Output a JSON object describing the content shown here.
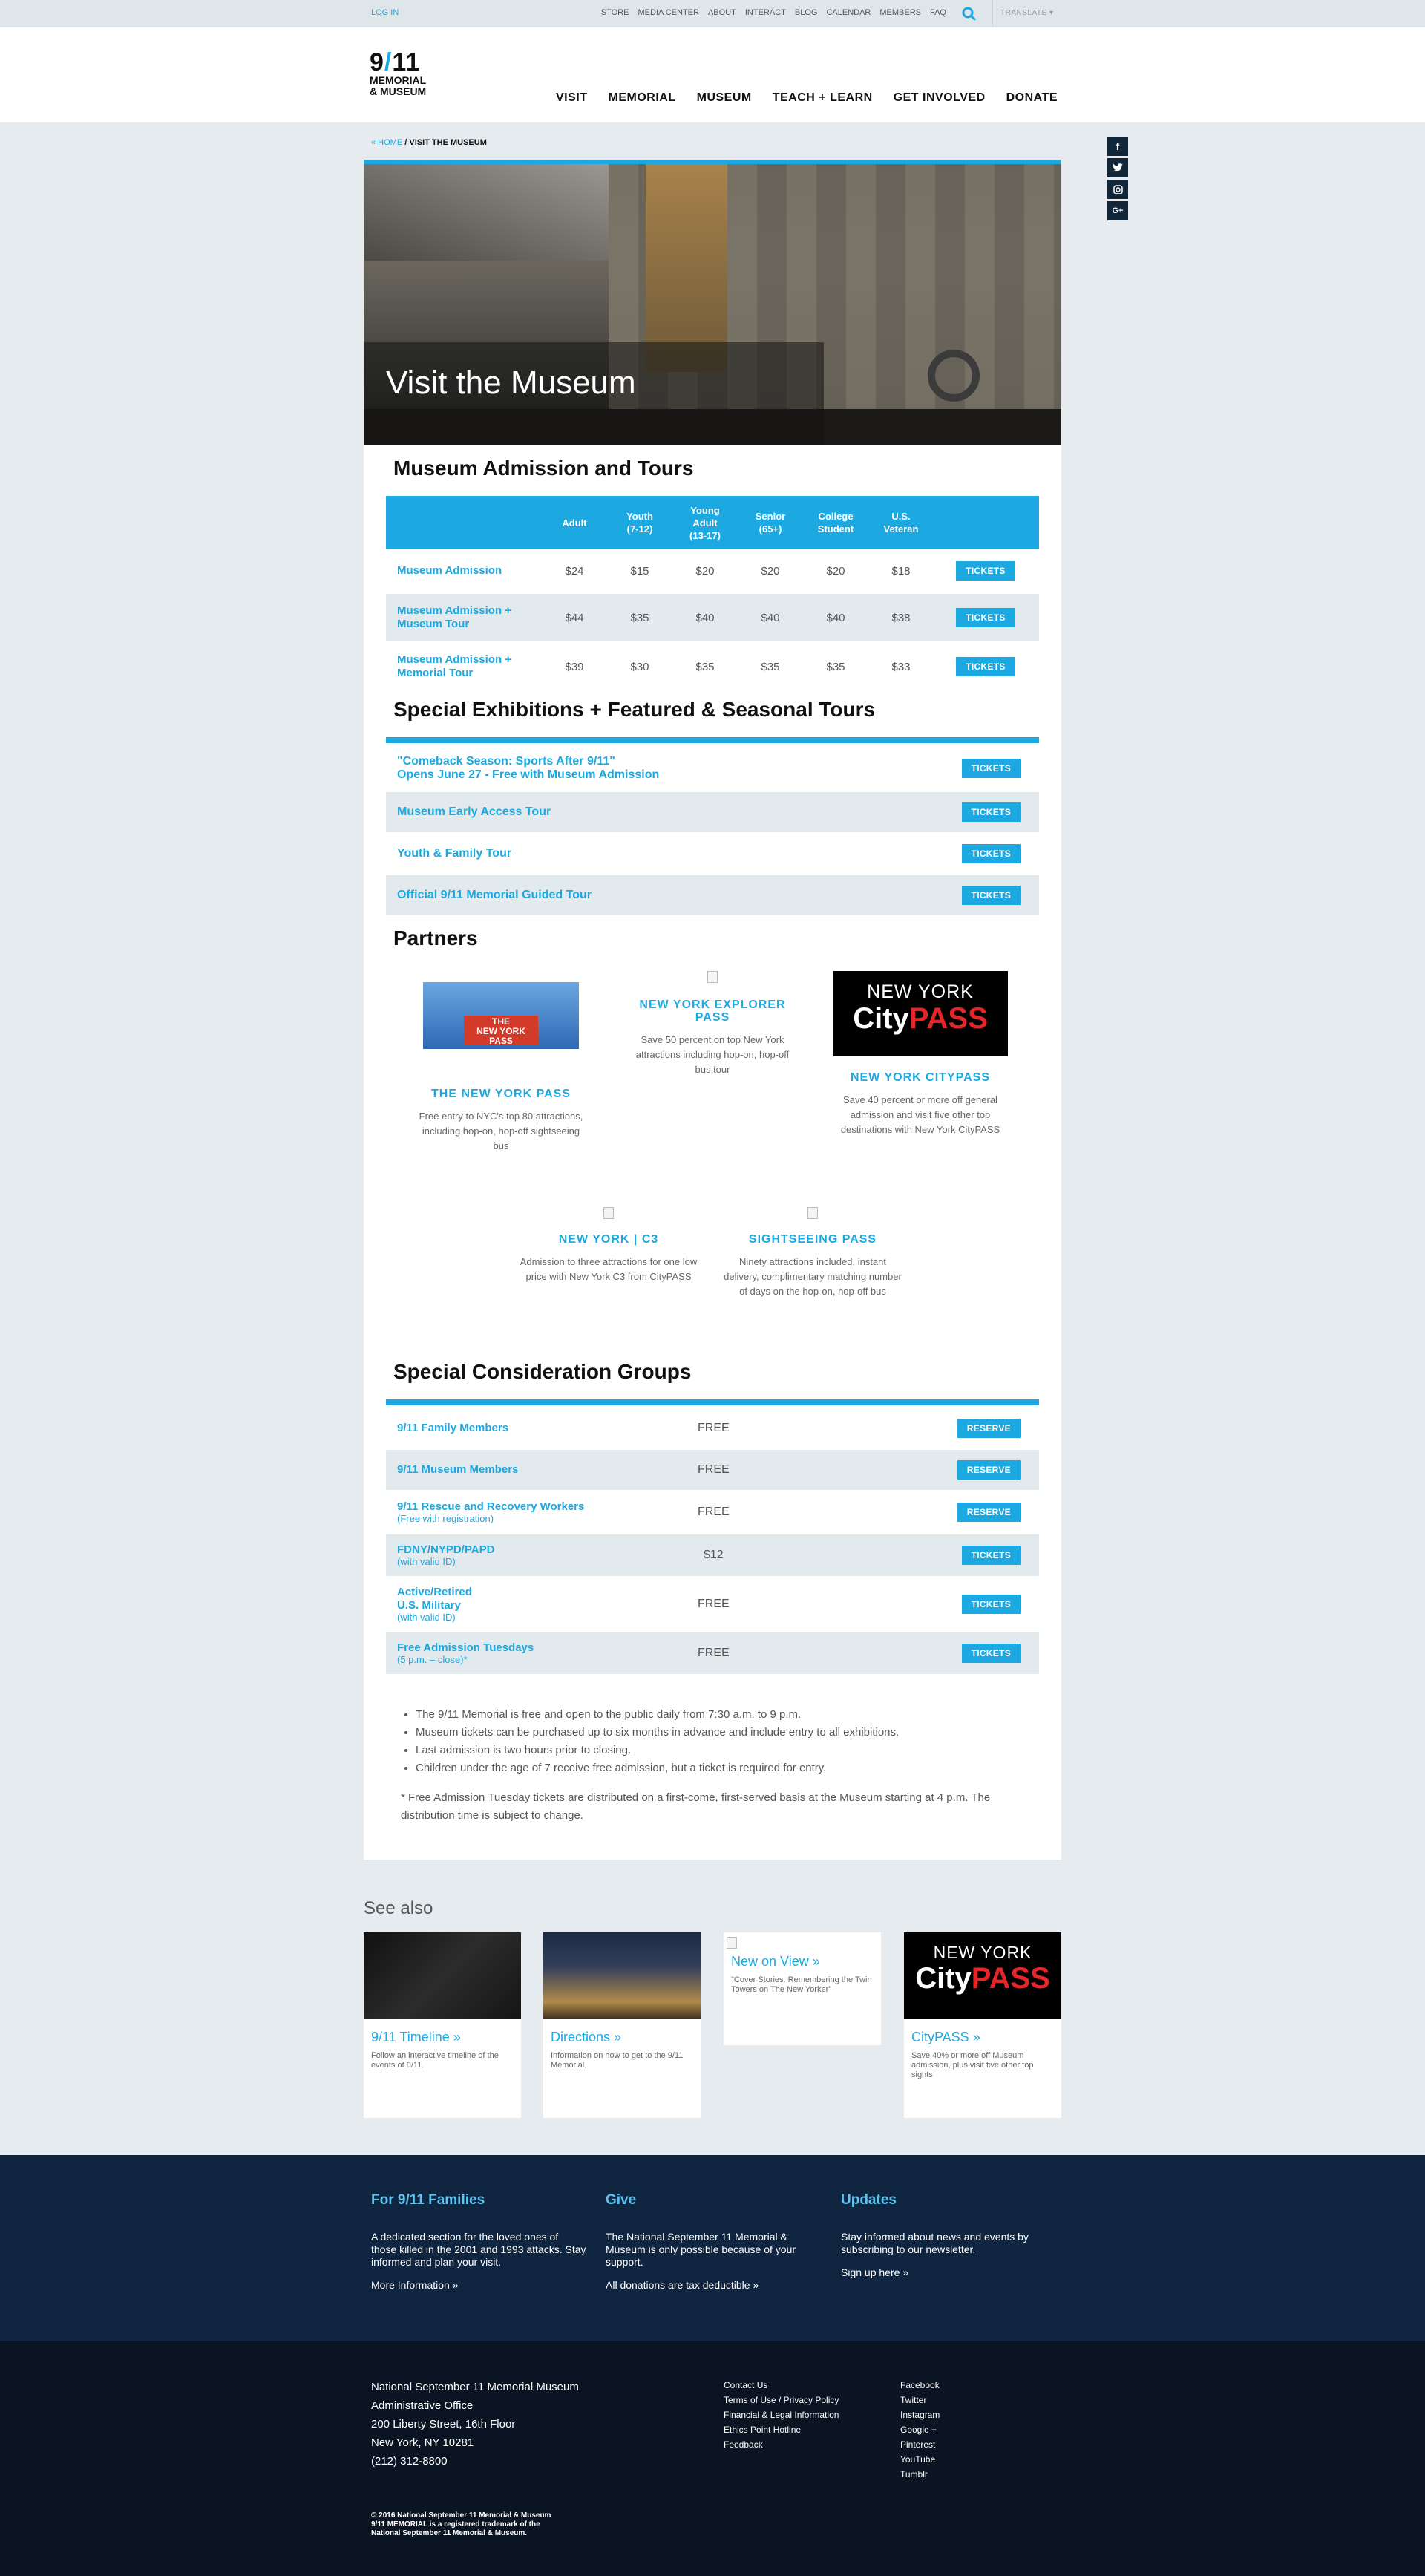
{
  "topbar": {
    "login": "LOG IN",
    "utility_nav": [
      "STORE",
      "MEDIA CENTER",
      "ABOUT",
      "INTERACT",
      "BLOG",
      "CALENDAR",
      "MEMBERS",
      "FAQ"
    ],
    "translate": "TRANSLATE ▾"
  },
  "logo": {
    "line1": "9",
    "slash": "/",
    "line1b": "11",
    "line2": "MEMORIAL",
    "line3": "& MUSEUM"
  },
  "main_nav": [
    "VISIT",
    "MEMORIAL",
    "MUSEUM",
    "TEACH + LEARN",
    "GET INVOLVED",
    "DONATE"
  ],
  "breadcrumb": {
    "home": "« HOME",
    "sep": " / ",
    "current": "VISIT THE MUSEUM"
  },
  "social": [
    "f",
    "t",
    "◘",
    "G+"
  ],
  "hero": {
    "title": "Visit the Museum"
  },
  "admission": {
    "heading": "Museum Admission and Tours",
    "columns": [
      "Adult",
      "Youth\n(7-12)",
      "Young\nAdult\n(13-17)",
      "Senior\n(65+)",
      "College\nStudent",
      "U.S.\nVeteran"
    ],
    "rows": [
      {
        "label": "Museum Admission",
        "prices": [
          "$24",
          "$15",
          "$20",
          "$20",
          "$20",
          "$18"
        ],
        "button": "TICKETS"
      },
      {
        "label": "Museum Admission + Museum Tour",
        "prices": [
          "$44",
          "$35",
          "$40",
          "$40",
          "$40",
          "$38"
        ],
        "button": "TICKETS"
      },
      {
        "label": "Museum Admission + Memorial Tour",
        "prices": [
          "$39",
          "$30",
          "$35",
          "$35",
          "$35",
          "$33"
        ],
        "button": "TICKETS"
      }
    ]
  },
  "special": {
    "heading": "Special Exhibitions + Featured & Seasonal Tours",
    "rows": [
      {
        "label": "\"Comeback Season: Sports After 9/11\"\nOpens June 27 - Free with Museum Admission",
        "button": "TICKETS"
      },
      {
        "label": "Museum Early Access Tour",
        "button": "TICKETS"
      },
      {
        "label": "Youth & Family Tour",
        "button": "TICKETS"
      },
      {
        "label": "Official 9/11 Memorial Guided Tour",
        "button": "TICKETS"
      }
    ]
  },
  "partners": {
    "heading": "Partners",
    "items": [
      {
        "name": "THE NEW YORK PASS",
        "desc": "Free entry to NYC's top 80 attractions, including hop-on, hop-off sightseeing bus",
        "logo_text": "THE\nNEW YORK\nPASS"
      },
      {
        "name": "NEW YORK EXPLORER PASS",
        "desc": "Save 50 percent on top New York attractions including hop-on, hop-off bus tour"
      },
      {
        "name": "NEW YORK CITYPASS",
        "desc": "Save 40 percent or more off general admission and visit five other top destinations with New York CityPASS",
        "logo_top": "NEW YORK",
        "logo_city": "City",
        "logo_pass": "PASS"
      },
      {
        "name": "NEW YORK | C3",
        "desc": "Admission to three attractions for one low price with New York C3 from CityPASS"
      },
      {
        "name": "SIGHTSEEING PASS",
        "desc": "Ninety attractions included, instant delivery, complimentary matching number of days on the hop-on, hop-off bus"
      }
    ]
  },
  "groups": {
    "heading": "Special Consideration Groups",
    "rows": [
      {
        "label": "9/11 Family Members",
        "sub": "",
        "price": "FREE",
        "button": "RESERVE"
      },
      {
        "label": "9/11 Museum Members",
        "sub": "",
        "price": "FREE",
        "button": "RESERVE"
      },
      {
        "label": "9/11 Rescue and Recovery Workers",
        "sub": "(Free with registration)",
        "price": "FREE",
        "button": "RESERVE"
      },
      {
        "label": "FDNY/NYPD/PAPD",
        "sub": "(with valid ID)",
        "price": "$12",
        "button": "TICKETS"
      },
      {
        "label": "Active/Retired\nU.S. Military",
        "sub": "(with valid ID)",
        "price": "FREE",
        "button": "TICKETS"
      },
      {
        "label": "Free Admission Tuesdays",
        "sub": "(5 p.m. – close)*",
        "price": "FREE",
        "button": "TICKETS"
      }
    ]
  },
  "notes": {
    "bullets": [
      "The 9/11 Memorial is free and open to the public daily from 7:30 a.m. to 9 p.m.",
      "Museum tickets can be purchased up to six months in advance and include entry to all exhibitions.",
      "Last admission is two hours prior to closing.",
      "Children under the age of 7 receive free admission, but a ticket is required for entry."
    ],
    "footnote": "* Free Admission Tuesday tickets are distributed on a first-come, first-served basis at the Museum starting at 4 p.m. The distribution time is subject to change."
  },
  "see_also": {
    "heading": "See also",
    "items": [
      {
        "title": "9/11 Timeline »",
        "desc": "Follow an interactive timeline of the events of 9/11."
      },
      {
        "title": "Directions »",
        "desc": "Information on how to get to the 9/11 Memorial."
      },
      {
        "title": "New on View »",
        "desc": "\"Cover Stories: Remembering the Twin Towers on The New Yorker\""
      },
      {
        "title": "CityPASS »",
        "desc": "Save 40% or more off Museum admission, plus visit five other top sights"
      }
    ]
  },
  "family_section": [
    {
      "title": "For 9/11 Families",
      "text": "A dedicated section for the loved ones of those killed in the 2001 and 1993 attacks. Stay informed and plan your visit.",
      "link": "More Information »"
    },
    {
      "title": "Give",
      "text": "The National September 11 Memorial & Museum is only possible because of your support.",
      "link": "All donations are tax deductible »"
    },
    {
      "title": "Updates",
      "text": "Stay informed about news and events by subscribing to our newsletter.",
      "link": "Sign up here »"
    }
  ],
  "footer": {
    "address": [
      "National September 11 Memorial Museum",
      "Administrative Office",
      "200 Liberty Street, 16th Floor",
      "New York, NY 10281",
      "(212) 312-8800"
    ],
    "links": [
      "Contact Us",
      "Terms of Use / Privacy Policy",
      "Financial & Legal Information",
      "Ethics Point Hotline",
      "Feedback"
    ],
    "social_links": [
      "Facebook",
      "Twitter",
      "Instagram",
      "Google +",
      "Pinterest",
      "YouTube",
      "Tumblr"
    ],
    "copyright": [
      "© 2016 National September 11 Memorial & Museum",
      "9/11 MEMORIAL is a registered trademark of the",
      "National September 11 Memorial & Museum."
    ]
  },
  "colors": {
    "accent": "#1ca8e0",
    "navy": "#0f2540",
    "footer": "#0b1422",
    "page_bg": "#e5ebee"
  }
}
